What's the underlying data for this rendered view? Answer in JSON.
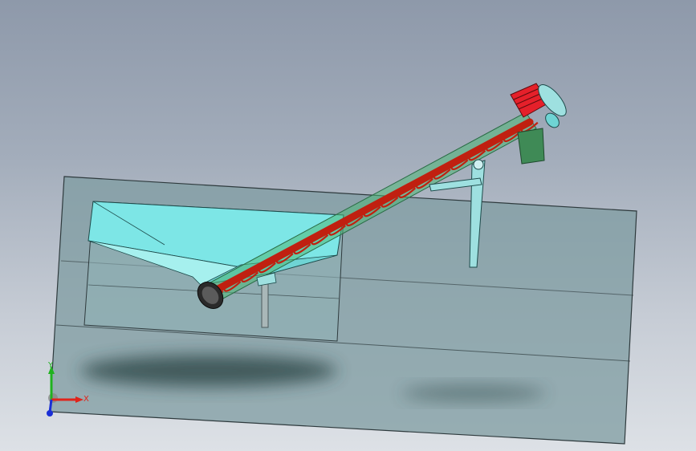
{
  "viewport": {
    "background_top": "#8e99aa",
    "background_bottom": "#dde1e6"
  },
  "triad": {
    "x_label": "X",
    "y_label": "Y",
    "x_color": "#e0241b",
    "y_color": "#1fb21f",
    "z_color": "#1a2fd6"
  },
  "model": {
    "colors": {
      "frame": "#7f9ca2",
      "hopper": "#7de6e6",
      "tube": "#4fb877",
      "screw": "#c02010",
      "motor": "#e5202a",
      "gear_housing": "#3f8a56",
      "support": "#9ee0e0",
      "shadow": "#26403f"
    },
    "icons": [
      "screw-conveyor-model",
      "hopper",
      "motor",
      "support-leg",
      "view-triad"
    ]
  }
}
